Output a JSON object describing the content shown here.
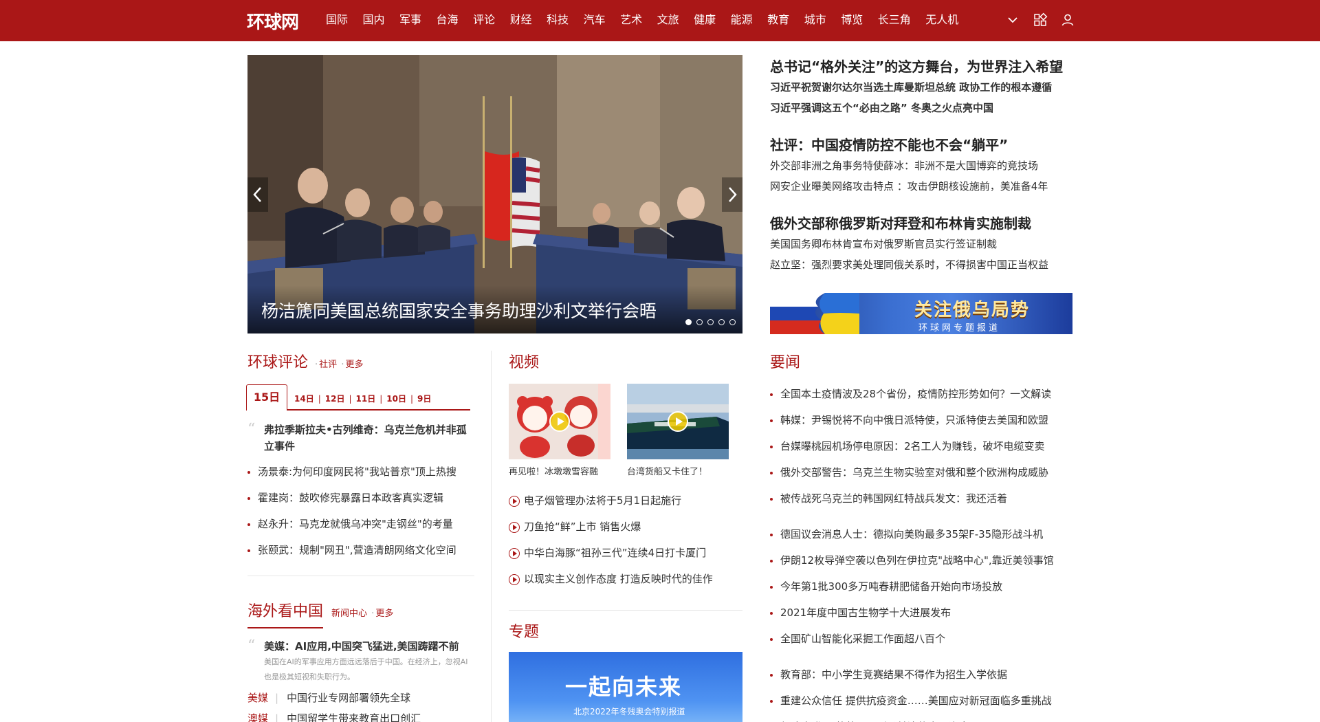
{
  "header": {
    "logo_text": "环球网",
    "nav": [
      "国际",
      "国内",
      "军事",
      "台海",
      "评论",
      "财经",
      "科技",
      "汽车",
      "艺术",
      "文旅",
      "健康",
      "能源",
      "教育",
      "城市",
      "博览",
      "长三角",
      "无人机"
    ],
    "icons": [
      "chevron-down-icon",
      "grid-icon",
      "user-icon"
    ]
  },
  "hero": {
    "caption": "杨洁篪同美国总统国家安全事务助理沙利文举行会晤",
    "slide_count": 5,
    "active_slide": 1
  },
  "top_news": [
    {
      "headline": "总书记“格外关注”的这方舞台，为世界注入希望",
      "subs": [
        "习近平祝贺谢尔达尔当选土库曼斯坦总统 政协工作的根本遵循",
        "习近平强调这五个“必由之路” 冬奥之火点亮中国"
      ],
      "subs_bold": true
    },
    {
      "headline": "社评：中国疫情防控不能也不会“躺平”",
      "subs": [
        "外交部非洲之角事务特使薛冰：非洲不是大国博弈的竞技场",
        "网安企业曝美网络攻击特点 ：攻击伊朗核设施前，美准备4年"
      ],
      "subs_bold": false
    },
    {
      "headline": "俄外交部称俄罗斯对拜登和布林肯实施制裁",
      "subs": [
        "美国国务卿布林肯宣布对俄罗斯官员实行签证制裁",
        "赵立坚：强烈要求美处理同俄关系时，不得损害中国正当权益"
      ],
      "subs_bold": false
    }
  ],
  "banner": {
    "title": "关注俄乌局势",
    "subtitle": "环球网专题报道"
  },
  "commentary": {
    "title": "环球评论",
    "links": [
      "社评",
      "更多"
    ],
    "date_tabs": [
      "15日",
      "14日",
      "12日",
      "11日",
      "10日",
      "9日"
    ],
    "featured": "弗拉季斯拉夫•古列维奇：乌克兰危机并非孤立事件",
    "items": [
      "汤景泰:为何印度网民将\"我站普京\"顶上热搜",
      "霍建岗：鼓吹修宪暴露日本政客真实逻辑",
      "赵永升：马克龙就俄乌冲突\"走钢丝\"的考量",
      "张颐武：规制\"网丑\",营造清朗网络文化空间"
    ]
  },
  "overseas": {
    "title": "海外看中国",
    "links": [
      "新闻中心",
      "更多"
    ],
    "featured_title": "美媒：AI应用,中国突飞猛进,美国踌躇不前",
    "featured_desc": "美国在AI的军事应用方面远远落后于中国。在经济上，忽视AI也是极其短视和失职行为。",
    "rows": [
      {
        "tag": "美媒",
        "text": "中国行业专网部署领先全球"
      },
      {
        "tag": "澳媒",
        "text": "中国留学生带来教育出口创汇"
      }
    ]
  },
  "video": {
    "title": "视频",
    "cards": [
      {
        "caption": "再见啦！冰墩墩雪容融"
      },
      {
        "caption": "台湾货船又卡住了！"
      }
    ],
    "items": [
      "电子烟管理办法将于5月1日起施行",
      "刀鱼抢“鲜”上市 销售火爆",
      "中华白海豚“祖孙三代”连续4日打卡厦门",
      "以现实主义创作态度 打造反映时代的佳作"
    ]
  },
  "special": {
    "title": "专题",
    "image_title": "一起向未来",
    "image_sub": "北京2022年冬残奥会特别报道"
  },
  "important": {
    "title": "要闻",
    "group1": [
      "全国本土疫情波及28个省份，疫情防控形势如何？一文解读",
      "韩媒：尹锡悦将不向中俄日派特使，只派特使去美国和欧盟",
      "台媒曝桃园机场停电原因：2名工人为赚钱，破坏电缆变卖",
      "俄外交部警告：乌克兰生物实验室对俄和整个欧洲构成威胁",
      "被传战死乌克兰的韩国网红特战兵发文：我还活着"
    ],
    "group2": [
      "德国议会消息人士：德拟向美购最多35架F-35隐形战斗机",
      "伊朗12枚导弹空袭以色列在伊拉克\"战略中心\",靠近美领事馆",
      "今年第1批300多万吨春耕肥储备开始向市场投放",
      "2021年度中国古生物学十大进展发布",
      "全国矿山智能化采掘工作面超八百个"
    ],
    "group3": [
      "教育部：中小学生竞赛结果不得作为招生入学依据",
      "重建公众信任 提供抗疫资金……美国应对新冠面临多重挑战",
      "复才席登 王英英展现刚柔并济的青且姿态"
    ]
  },
  "colors": {
    "brand_red": "#aa1717"
  }
}
